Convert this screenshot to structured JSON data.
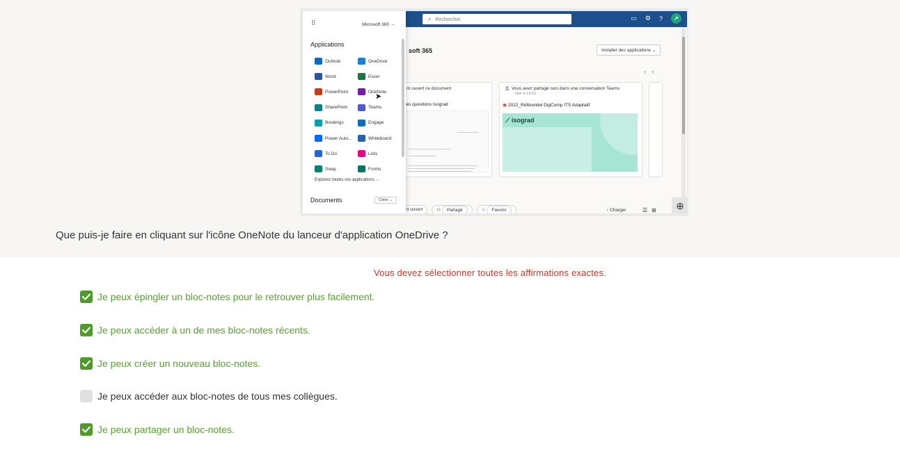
{
  "screenshot": {
    "launcher": {
      "m365_link": "Microsoft 365",
      "apps_heading": "Applications",
      "apps": [
        {
          "label": "Outlook",
          "color": "#0f6cbd"
        },
        {
          "label": "OneDrive",
          "color": "#1e7fd8"
        },
        {
          "label": "Word",
          "color": "#2b579a"
        },
        {
          "label": "Excel",
          "color": "#217346"
        },
        {
          "label": "PowerPoint",
          "color": "#c43e1c"
        },
        {
          "label": "OneNote",
          "color": "#7719aa"
        },
        {
          "label": "SharePoint",
          "color": "#038387"
        },
        {
          "label": "Teams",
          "color": "#5059c9"
        },
        {
          "label": "Bookings",
          "color": "#00a2ad"
        },
        {
          "label": "Engage",
          "color": "#0f6cbd"
        },
        {
          "label": "Power Auto...",
          "color": "#0066ff"
        },
        {
          "label": "Whiteboard",
          "color": "#2a62a8"
        },
        {
          "label": "To Do",
          "color": "#2564cf"
        },
        {
          "label": "Lists",
          "color": "#e3008c"
        },
        {
          "label": "Sway",
          "color": "#008272"
        },
        {
          "label": "Forms",
          "color": "#077568"
        }
      ],
      "explore_link": "Explorez toutes vos applications",
      "docs_heading": "Documents",
      "create_button": "Créer"
    },
    "search_placeholder": "Rechercher",
    "page_title": "soft 365",
    "install_button": "Installer des applications",
    "card1_head": "nt ouvert ce document",
    "card1_doc": "des questions Isograd",
    "card2_head": "Vous avez partagé ceci dans une conversation Teams",
    "card2_sub": "Hier à 13:53",
    "card2_doc": "2022_Référentiel DigComp ITS Adaptatif",
    "isograd_logo": "isograd",
    "bottom_tabs": [
      "nt ouvert",
      "Partagé",
      "Favoris"
    ],
    "upload_label": "Charger"
  },
  "question": "Que puis-je faire en cliquant sur l'icône OneNote du lanceur d'application OneDrive ?",
  "instruction": "Vous devez sélectionner toutes les affirmations exactes.",
  "options": [
    {
      "label": "Je peux épingler un bloc-notes pour le retrouver plus facilement.",
      "checked": true
    },
    {
      "label": "Je peux accéder à un de mes bloc-notes récents.",
      "checked": true
    },
    {
      "label": "Je peux créer un nouveau bloc-notes.",
      "checked": true
    },
    {
      "label": "Je peux accéder aux bloc-notes de tous mes collègues.",
      "checked": false
    },
    {
      "label": "Je peux partager un bloc-notes.",
      "checked": true
    }
  ],
  "colors": {
    "checked": "#4e9a2a",
    "checked_text": "#58a12f",
    "instruction": "#c0392b"
  }
}
